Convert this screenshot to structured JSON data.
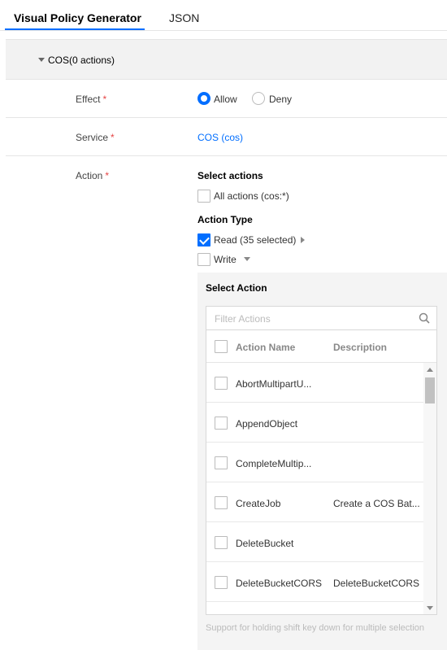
{
  "tabs": [
    {
      "label": "Visual Policy Generator",
      "active": true
    },
    {
      "label": "JSON",
      "active": false
    }
  ],
  "section": {
    "title": "COS(0 actions)"
  },
  "effect": {
    "label": "Effect",
    "required_mark": "*",
    "options": [
      {
        "label": "Allow",
        "selected": true
      },
      {
        "label": "Deny",
        "selected": false
      }
    ]
  },
  "service": {
    "label": "Service",
    "required_mark": "*",
    "value": "COS (cos)"
  },
  "action": {
    "label": "Action",
    "required_mark": "*",
    "select_actions_title": "Select actions",
    "all_actions_label": "All actions (cos:*)",
    "action_type_title": "Action Type",
    "types": [
      {
        "label": "Read (35 selected)",
        "checked": true
      },
      {
        "label": "Write",
        "checked": false
      }
    ]
  },
  "select_action": {
    "title": "Select Action",
    "filter_placeholder": "Filter Actions",
    "columns": [
      "Action Name",
      "Description"
    ],
    "rows": [
      {
        "name": "AbortMultipartU...",
        "description": ""
      },
      {
        "name": "AppendObject",
        "description": ""
      },
      {
        "name": "CompleteMultip...",
        "description": ""
      },
      {
        "name": "CreateJob",
        "description": "Create a COS Bat..."
      },
      {
        "name": "DeleteBucket",
        "description": ""
      },
      {
        "name": "DeleteBucketCORS",
        "description": "DeleteBucketCORS"
      }
    ],
    "hint": "Support for holding shift key down for multiple selection"
  },
  "colors": {
    "accent": "#006eff",
    "required": "#e54545"
  }
}
